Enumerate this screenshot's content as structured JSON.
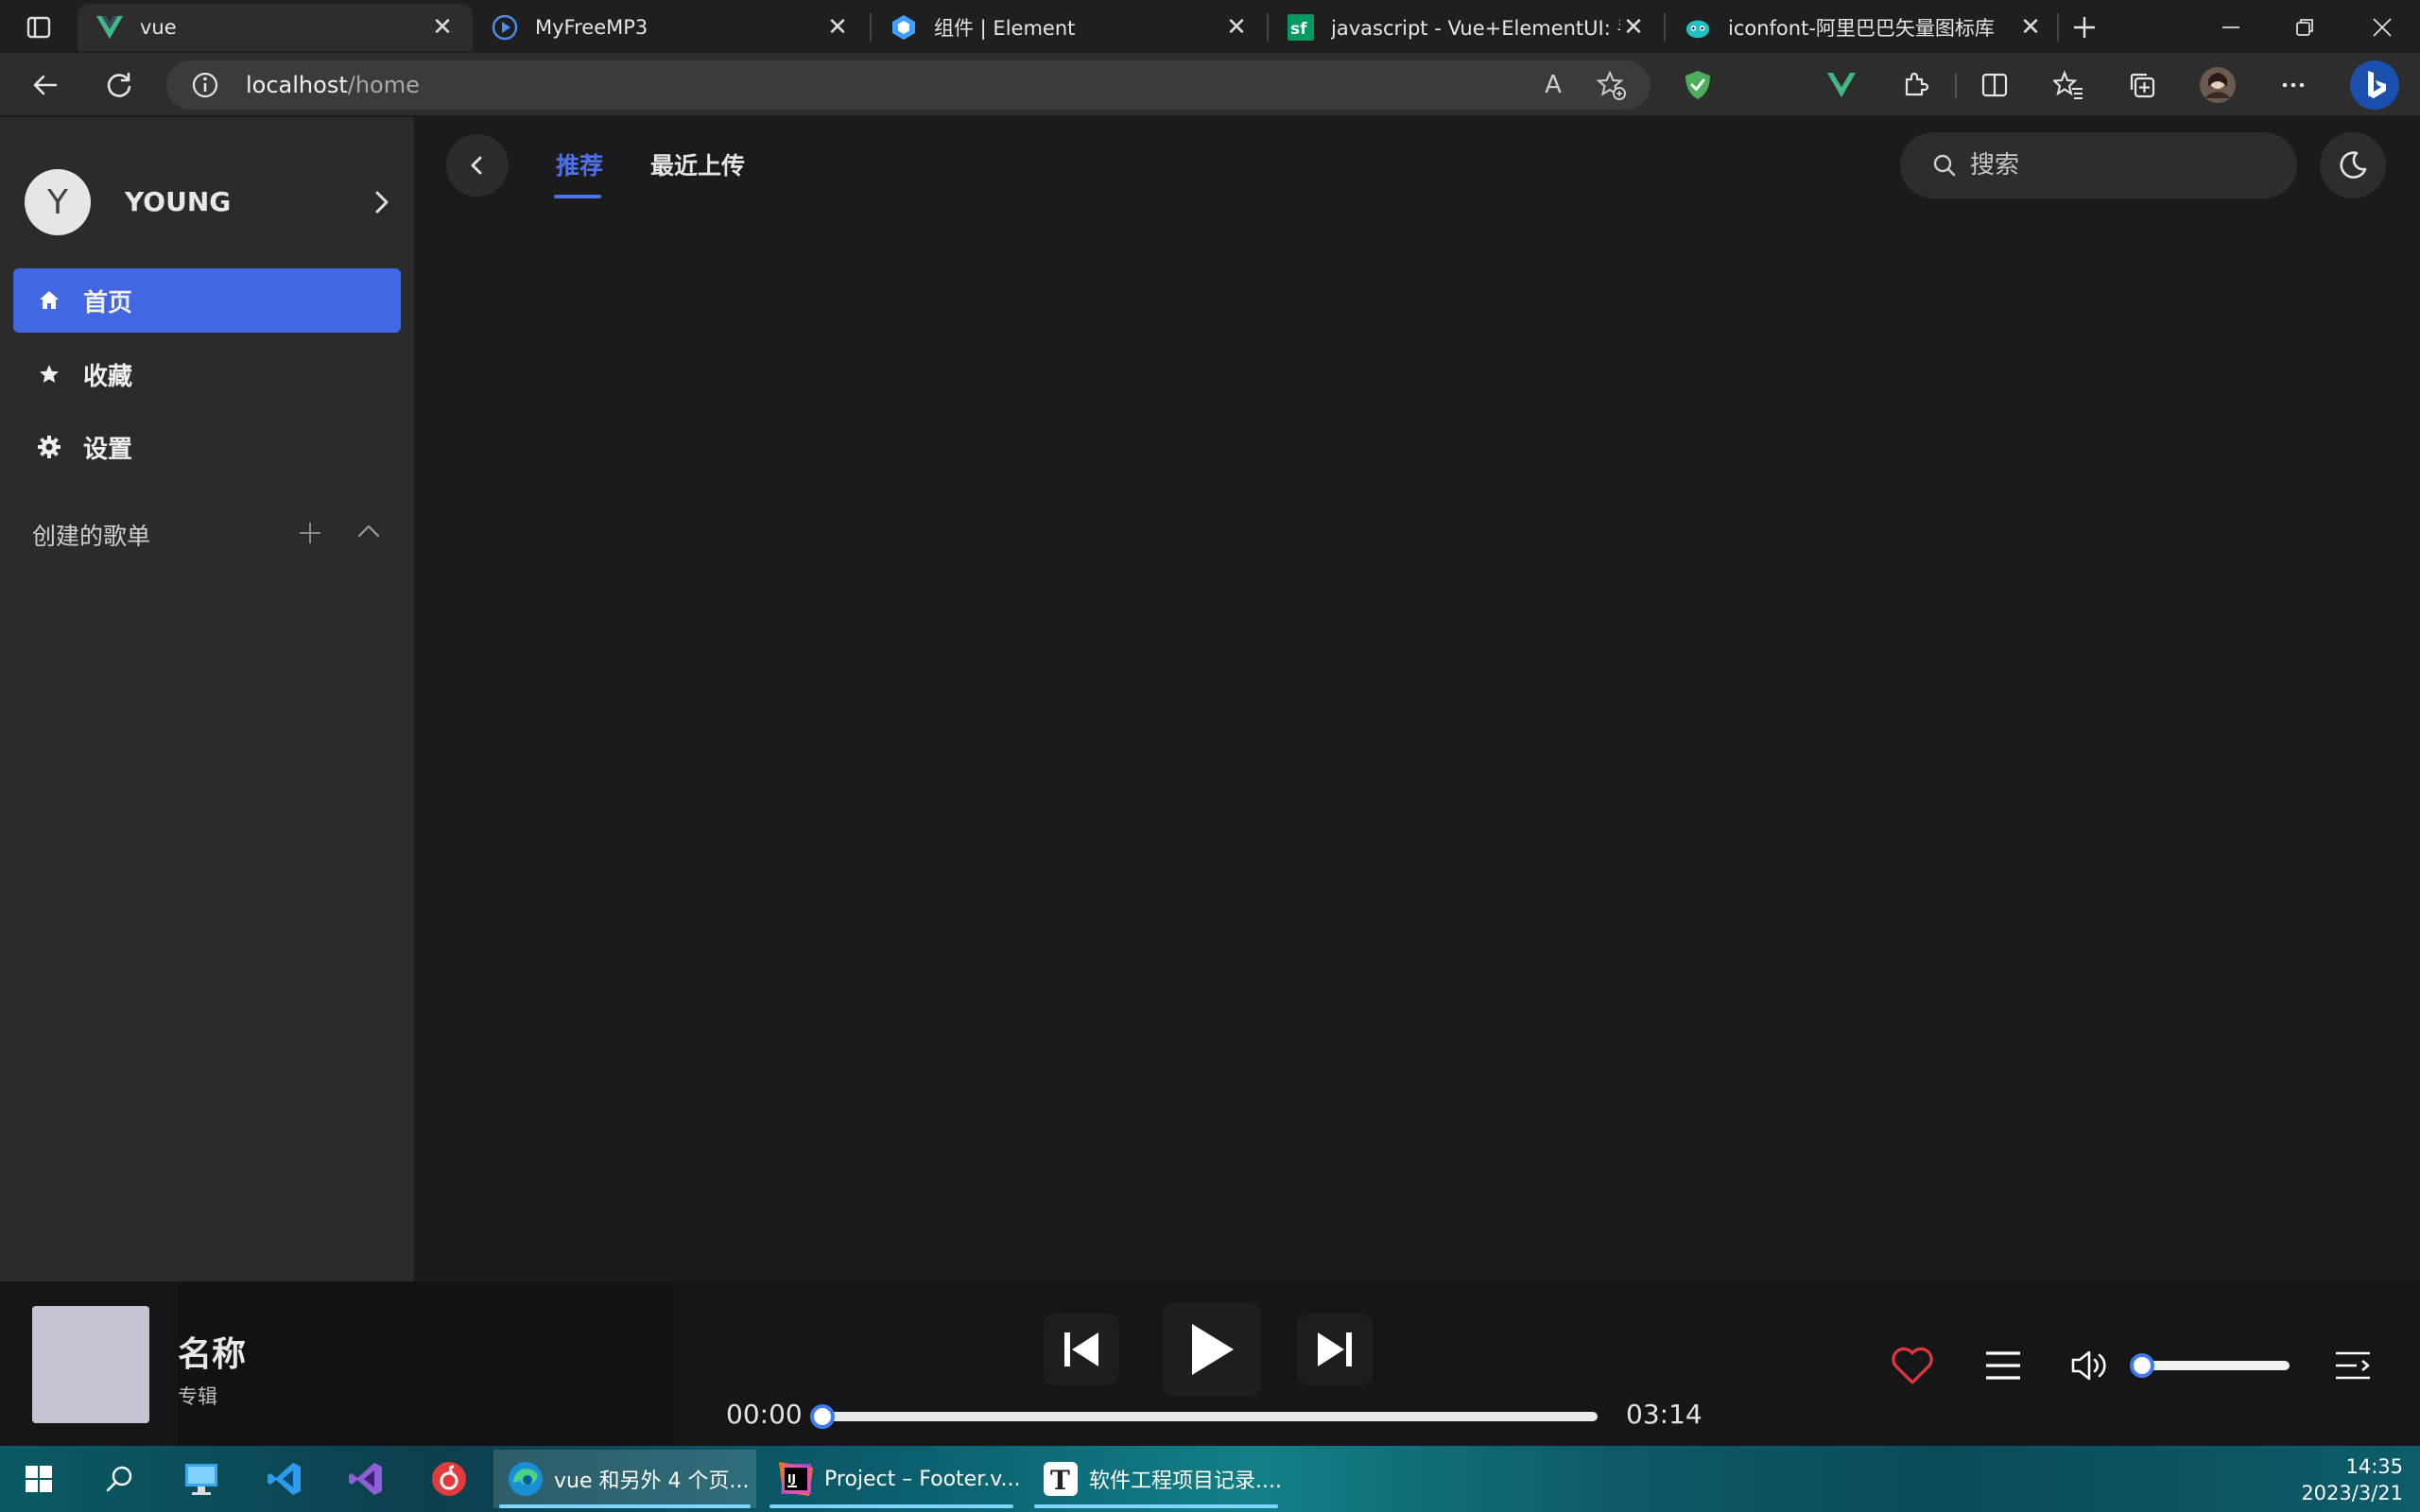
{
  "browser": {
    "tabs": [
      {
        "title": "vue",
        "active": true
      },
      {
        "title": "MyFreeMP3",
        "active": false
      },
      {
        "title": "组件 | Element",
        "active": false
      },
      {
        "title": "javascript - Vue+ElementUI: 手把",
        "active": false
      },
      {
        "title": "iconfont-阿里巴巴矢量图标库",
        "active": false
      }
    ],
    "url_host": "localhost",
    "url_path": "/home",
    "read_aloud_label": "A"
  },
  "sidebar": {
    "avatar_letter": "Y",
    "username": "YOUNG",
    "menu": [
      {
        "label": "首页",
        "icon": "home-icon",
        "active": true
      },
      {
        "label": "收藏",
        "icon": "star-icon",
        "active": false
      },
      {
        "label": "设置",
        "icon": "gear-icon",
        "active": false
      }
    ],
    "playlist_header": "创建的歌单"
  },
  "main": {
    "tabs": [
      {
        "label": "推荐",
        "active": true
      },
      {
        "label": "最近上传",
        "active": false
      }
    ],
    "search_placeholder": "搜索"
  },
  "player": {
    "song_name": "名称",
    "album": "专辑",
    "current_time": "00:00",
    "total_time": "03:14",
    "progress": 0,
    "volume": 0,
    "liked": false
  },
  "taskbar": {
    "apps": [
      {
        "label": "vue 和另外 4 个页..."
      },
      {
        "label": "Project – Footer.v..."
      },
      {
        "label": "软件工程项目记录...."
      }
    ],
    "time": "14:35",
    "date": "2023/3/21"
  },
  "colors": {
    "accent": "#4167e3",
    "active_tab_text": "#4d72e8",
    "like_heart": "#e0383e",
    "sidebar_bg": "#2b2b2e",
    "main_bg": "#1b1b1d"
  }
}
